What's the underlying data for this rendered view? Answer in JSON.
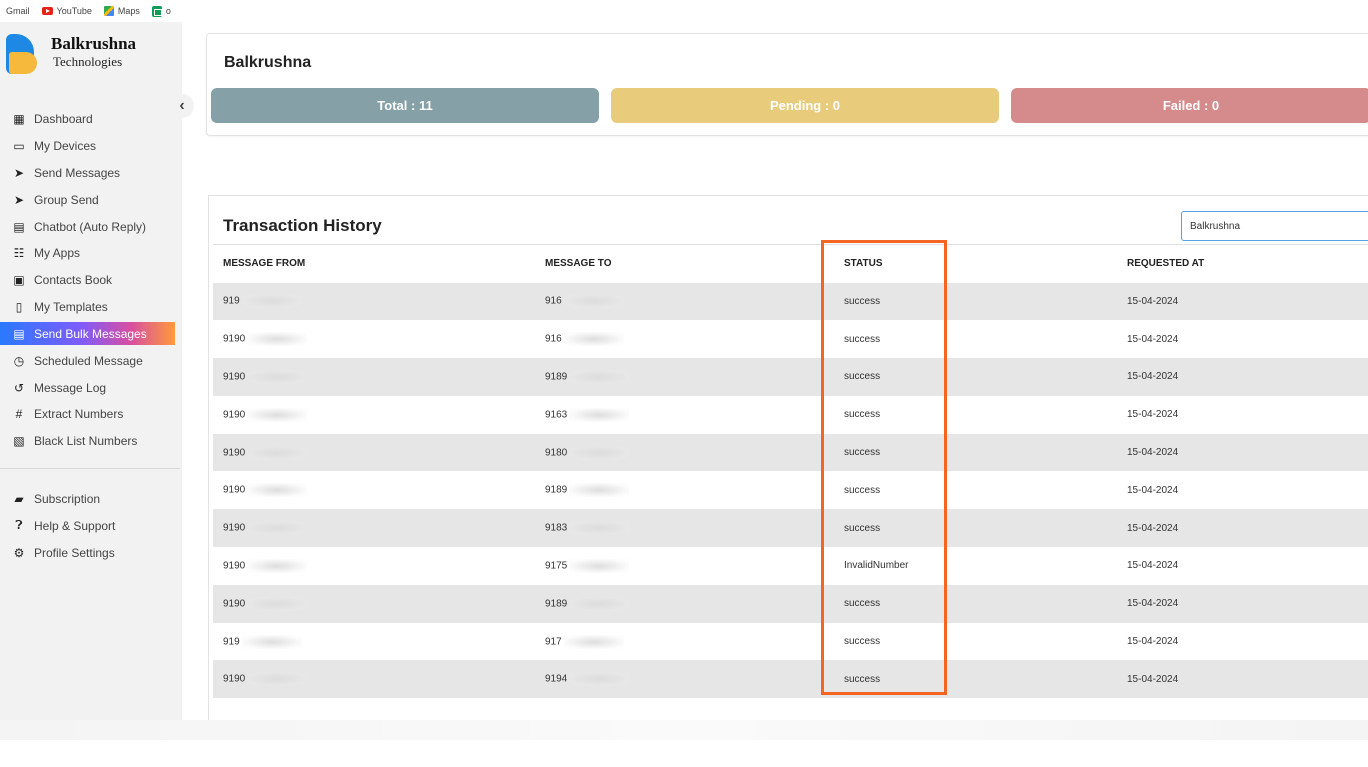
{
  "bookmarks": [
    {
      "label": "Gmail",
      "icon": "gmail"
    },
    {
      "label": "YouTube",
      "icon": "youtube-icon"
    },
    {
      "label": "Maps",
      "icon": "maps-icon"
    },
    {
      "label": "o",
      "icon": "sheets-icon"
    }
  ],
  "brand": {
    "title": "Balkrushna",
    "subtitle": "Technologies"
  },
  "sidebar": {
    "items": [
      {
        "label": "Dashboard",
        "icon": "dashboard-icon"
      },
      {
        "label": "My Devices",
        "icon": "devices-icon"
      },
      {
        "label": "Send Messages",
        "icon": "send-icon"
      },
      {
        "label": "Group Send",
        "icon": "send-icon"
      },
      {
        "label": "Chatbot (Auto Reply)",
        "icon": "chat-icon"
      },
      {
        "label": "My Apps",
        "icon": "apps-grid-icon"
      },
      {
        "label": "Contacts Book",
        "icon": "contacts-icon"
      },
      {
        "label": "My Templates",
        "icon": "file-icon"
      },
      {
        "label": "Send Bulk Messages",
        "icon": "file-text-icon",
        "active": true
      },
      {
        "label": "Scheduled Message",
        "icon": "clock-icon"
      },
      {
        "label": "Message Log",
        "icon": "history-icon"
      },
      {
        "label": "Extract Numbers",
        "icon": "hash-icon"
      },
      {
        "label": "Black List Numbers",
        "icon": "blacklist-icon"
      }
    ],
    "bottom_items": [
      {
        "label": "Subscription",
        "icon": "subscription-icon"
      },
      {
        "label": "Help & Support",
        "icon": "help-icon"
      },
      {
        "label": "Profile Settings",
        "icon": "gear-icon"
      }
    ]
  },
  "summary": {
    "title": "Balkrushna",
    "total": "Total : 11",
    "pending": "Pending : 0",
    "failed": "Failed : 0"
  },
  "transactions": {
    "title": "Transaction History",
    "search_value": "Balkrushna",
    "columns": [
      "MESSAGE FROM",
      "MESSAGE TO",
      "STATUS",
      "REQUESTED AT"
    ],
    "rows": [
      {
        "from": "919",
        "to": "916",
        "status": "success",
        "requested_at": "15-04-2024"
      },
      {
        "from": "9190",
        "to": "916",
        "status": "success",
        "requested_at": "15-04-2024"
      },
      {
        "from": "9190",
        "to": "9189",
        "status": "success",
        "requested_at": "15-04-2024"
      },
      {
        "from": "9190",
        "to": "9163",
        "status": "success",
        "requested_at": "15-04-2024"
      },
      {
        "from": "9190",
        "to": "9180",
        "status": "success",
        "requested_at": "15-04-2024"
      },
      {
        "from": "9190",
        "to": "9189",
        "status": "success",
        "requested_at": "15-04-2024"
      },
      {
        "from": "9190",
        "to": "9183",
        "status": "success",
        "requested_at": "15-04-2024"
      },
      {
        "from": "9190",
        "to": "9175",
        "status": "InvalidNumber",
        "requested_at": "15-04-2024"
      },
      {
        "from": "9190",
        "to": "9189",
        "status": "success",
        "requested_at": "15-04-2024"
      },
      {
        "from": "919",
        "to": "917",
        "status": "success",
        "requested_at": "15-04-2024"
      },
      {
        "from": "9190",
        "to": "9194",
        "status": "success",
        "requested_at": "15-04-2024"
      }
    ]
  },
  "colors": {
    "total": "#85a0a6",
    "pending": "#e8cc7c",
    "failed": "#d58b8b",
    "highlight": "#f26522"
  }
}
